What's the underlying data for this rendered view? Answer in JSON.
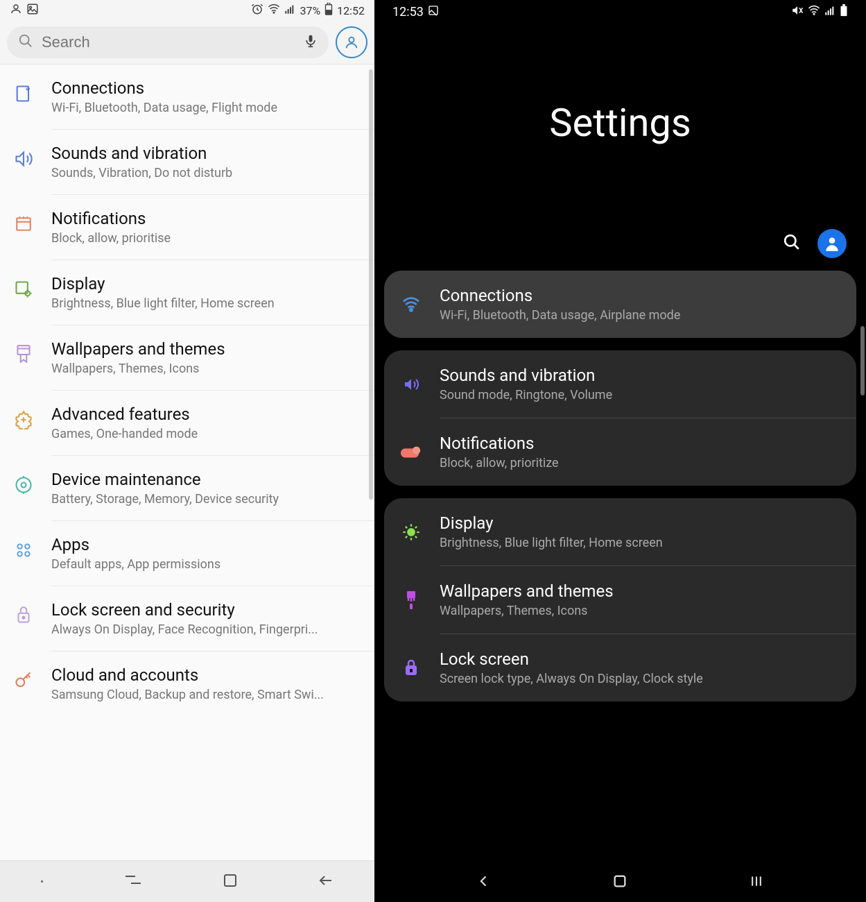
{
  "left": {
    "status": {
      "time": "12:52",
      "battery": "37%"
    },
    "search_placeholder": "Search",
    "items": [
      {
        "title": "Connections",
        "sub": "Wi-Fi, Bluetooth, Data usage, Flight mode",
        "color": "#5d7fd4"
      },
      {
        "title": "Sounds and vibration",
        "sub": "Sounds, Vibration, Do not disturb",
        "color": "#5d7fd4"
      },
      {
        "title": "Notifications",
        "sub": "Block, allow, prioritise",
        "color": "#e08060"
      },
      {
        "title": "Display",
        "sub": "Brightness, Blue light filter, Home screen",
        "color": "#6fa84f"
      },
      {
        "title": "Wallpapers and themes",
        "sub": "Wallpapers, Themes, Icons",
        "color": "#b48fd6"
      },
      {
        "title": "Advanced features",
        "sub": "Games, One-handed mode",
        "color": "#d6a447"
      },
      {
        "title": "Device maintenance",
        "sub": "Battery, Storage, Memory, Device security",
        "color": "#4fb8a8"
      },
      {
        "title": "Apps",
        "sub": "Default apps, App permissions",
        "color": "#5d9fd4"
      },
      {
        "title": "Lock screen and security",
        "sub": "Always On Display, Face Recognition, Fingerpri...",
        "color": "#b89fd6"
      },
      {
        "title": "Cloud and accounts",
        "sub": "Samsung Cloud, Backup and restore, Smart Swi...",
        "color": "#e08060"
      }
    ]
  },
  "right": {
    "status": {
      "time": "12:53"
    },
    "page_title": "Settings",
    "groups": [
      [
        {
          "title": "Connections",
          "sub": "Wi-Fi, Bluetooth, Data usage, Airplane mode",
          "icon": "wifi",
          "color": "#4a90e2"
        }
      ],
      [
        {
          "title": "Sounds and vibration",
          "sub": "Sound mode, Ringtone, Volume",
          "icon": "sound",
          "color": "#7a6cff"
        },
        {
          "title": "Notifications",
          "sub": "Block, allow, prioritize",
          "icon": "toggle",
          "color": "#f07868"
        }
      ],
      [
        {
          "title": "Display",
          "sub": "Brightness, Blue light filter, Home screen",
          "icon": "sun",
          "color": "#8be04f"
        },
        {
          "title": "Wallpapers and themes",
          "sub": "Wallpapers, Themes, Icons",
          "icon": "brush",
          "color": "#c04fe0"
        },
        {
          "title": "Lock screen",
          "sub": "Screen lock type, Always On Display, Clock style",
          "icon": "lock",
          "color": "#9a6cff"
        }
      ]
    ]
  }
}
